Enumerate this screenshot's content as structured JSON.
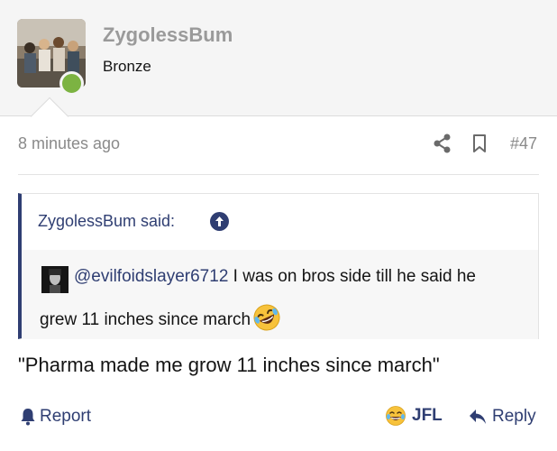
{
  "post": {
    "author": {
      "username": "ZygolessBum",
      "title": "Bronze",
      "avatar": "avatar-photo-group",
      "online_status_color": "#7cb342"
    },
    "timestamp": "8 minutes ago",
    "actions": {
      "share_icon": "share-icon",
      "bookmark_icon": "bookmark-icon"
    },
    "number": "#47",
    "quote": {
      "attribution": "ZygolessBum said:",
      "jump_icon": "arrow-up-circle-icon",
      "mention": "@evilfoidslayer6712",
      "line1_rest": " I was on bros side till he said he",
      "line2": "grew 11 inches since march",
      "emoji": "rolling-on-floor-laughing-emoji"
    },
    "message": "\"Pharma made me grow 11 inches since march\"",
    "footer": {
      "report_label": "Report",
      "reaction_label": "JFL",
      "reaction_emoji": "face-with-tears-of-joy-emoji",
      "reply_label": "Reply"
    }
  },
  "colors": {
    "accent": "#2f3e72",
    "muted": "#8a8a8a",
    "username": "#9a9a9a",
    "header_bg": "#f5f5f5"
  }
}
